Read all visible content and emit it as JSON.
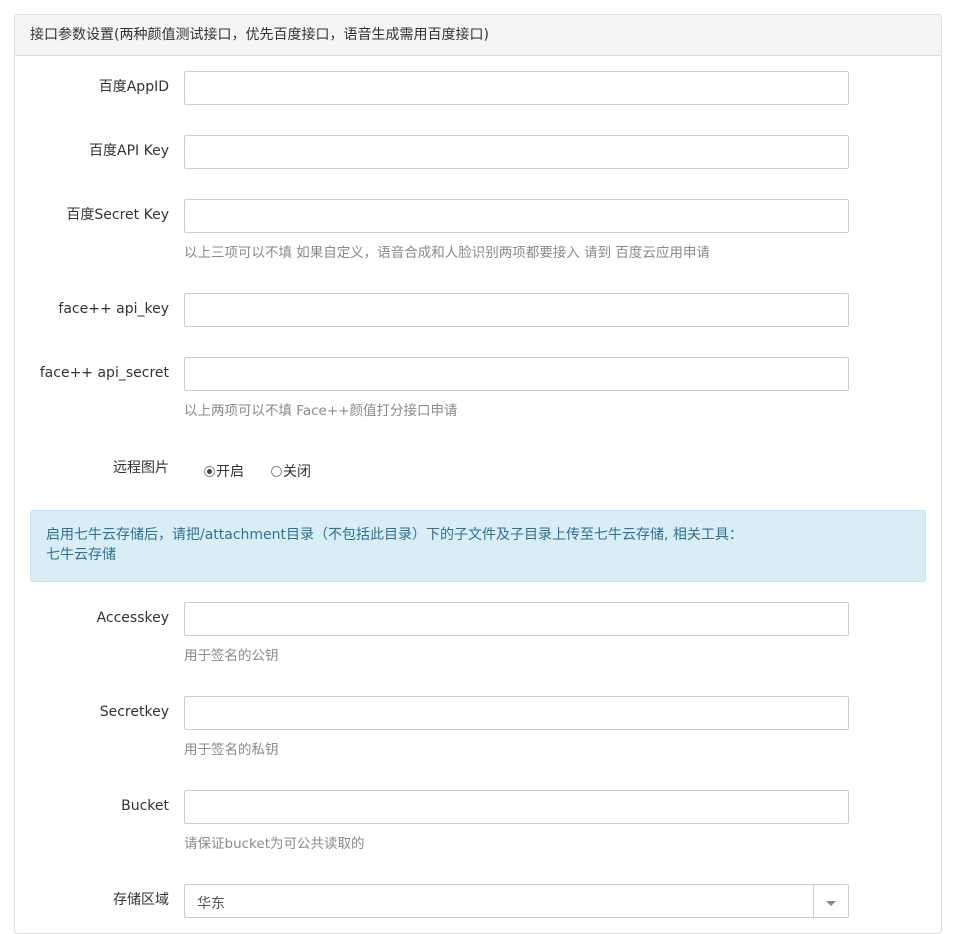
{
  "panel": {
    "title": "接口参数设置(两种颜值测试接口，优先百度接口，语音生成需用百度接口)"
  },
  "fields": {
    "baidu_appid": {
      "label": "百度AppID",
      "value": ""
    },
    "baidu_api_key": {
      "label": "百度API Key",
      "value": ""
    },
    "baidu_secret_key": {
      "label": "百度Secret Key",
      "value": "",
      "help": "以上三项可以不填 如果自定义，语音合成和人脸识别两项都要接入 请到 百度云应用申请"
    },
    "facepp_api_key": {
      "label": "face++ api_key",
      "value": ""
    },
    "facepp_api_secret": {
      "label": "face++ api_secret",
      "value": "",
      "help": "以上两项可以不填 Face++颜值打分接口申请"
    },
    "remote_image": {
      "label": "远程图片",
      "options": [
        "开启",
        "关闭"
      ],
      "selected": "开启"
    },
    "accesskey": {
      "label": "Accesskey",
      "value": "",
      "help": "用于签名的公钥"
    },
    "secretkey": {
      "label": "Secretkey",
      "value": "",
      "help": "用于签名的私钥"
    },
    "bucket": {
      "label": "Bucket",
      "value": "",
      "help": "请保证bucket为可公共读取的"
    },
    "region": {
      "label": "存储区域",
      "selected": "华东"
    }
  },
  "qiniu_notice": {
    "line1": "启用七牛云存储后，请把/attachment目录（不包括此目录）下的子文件及子目录上传至七牛云存储, 相关工具：",
    "line2": "七牛云存储"
  },
  "icons": {
    "select_arrow": "chevron-down-icon"
  }
}
